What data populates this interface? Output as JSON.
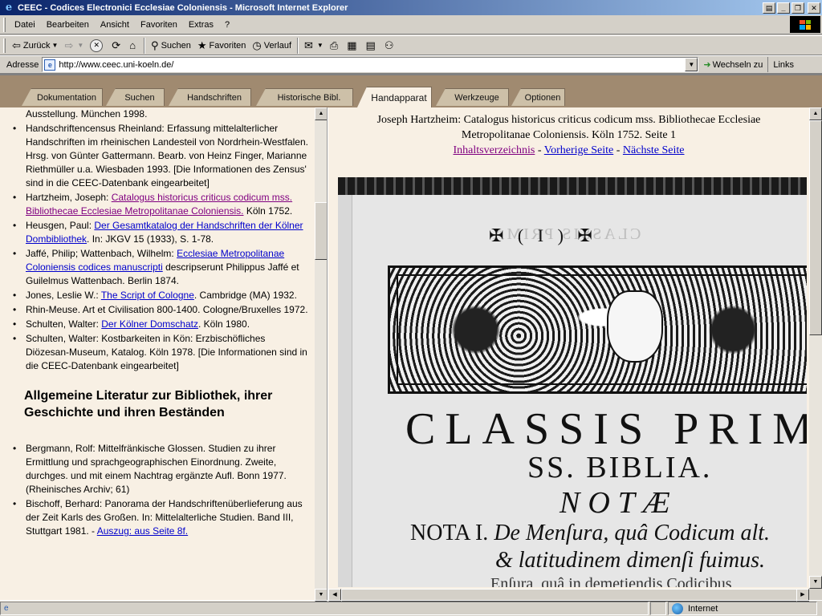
{
  "window": {
    "title": "CEEC - Codices Electronici Ecclesiae Coloniensis - Microsoft Internet Explorer"
  },
  "menu": [
    "Datei",
    "Bearbeiten",
    "Ansicht",
    "Favoriten",
    "Extras",
    "?"
  ],
  "toolbar": {
    "back": "Zurück",
    "search": "Suchen",
    "favorites": "Favoriten",
    "history": "Verlauf"
  },
  "address": {
    "label": "Adresse",
    "url": "http://www.ceec.uni-koeln.de/",
    "go": "Wechseln zu",
    "links": "Links"
  },
  "tabs": [
    {
      "label": "Dokumentation"
    },
    {
      "label": "Suchen"
    },
    {
      "label": "Handschriften"
    },
    {
      "label": "Historische Bibl."
    },
    {
      "label": "Handapparat"
    },
    {
      "label": "Werkzeuge"
    },
    {
      "label": "Optionen"
    }
  ],
  "active_tab": "Handapparat",
  "left": {
    "items_top": [
      {
        "pre": "Ausstellung. München 1998.",
        "link": "",
        "post": "",
        "bullet": false
      },
      {
        "pre": "Handschriftencensus Rheinland: Erfassung mittelalterlicher Handschriften im rheinischen Landesteil von Nordrhein-Westfalen. Hrsg. von Günter Gattermann. Bearb. von Heinz Finger, Marianne Riethmüller u.a. Wiesbaden 1993. [Die Informationen des Zensus' sind in die CEEC-Datenbank eingearbeitet]",
        "link": "",
        "post": "",
        "bullet": true
      },
      {
        "pre": "Hartzheim, Joseph: ",
        "link": "Catalogus historicus criticus codicum mss. Bibliothecae Ecclesiae Metropolitanae Coloniensis.",
        "post": " Köln 1752.",
        "bullet": true,
        "visited": true
      },
      {
        "pre": "Heusgen, Paul: ",
        "link": "Der Gesamtkatalog der Handschriften der Kölner Dombibliothek",
        "post": ". In: JKGV 15 (1933), S. 1-78.",
        "bullet": true
      },
      {
        "pre": "Jaffé, Philip; Wattenbach, Wilhelm: ",
        "link": "Ecclesiae Metropolitanae Coloniensis codices manuscripti",
        "post": " descripserunt Philippus Jaffé et Guilelmus Wattenbach. Berlin 1874.",
        "bullet": true
      },
      {
        "pre": "Jones, Leslie W.: ",
        "link": "The Script of Cologne",
        "post": ". Cambridge (MA) 1932.",
        "bullet": true
      },
      {
        "pre": "Rhin-Meuse. Art et Civilisation 800-1400. Cologne/Bruxelles 1972.",
        "link": "",
        "post": "",
        "bullet": true
      },
      {
        "pre": "Schulten, Walter: ",
        "link": "Der Kölner Domschatz",
        "post": ". Köln 1980.",
        "bullet": true
      },
      {
        "pre": "Schulten, Walter: Kostbarkeiten in Kön: Erzbischöfliches Diözesan-Museum, Katalog. Köln 1978. [Die Informationen sind in die CEEC-Datenbank eingearbeitet]",
        "link": "",
        "post": "",
        "bullet": true
      }
    ],
    "heading": "Allgemeine Literatur zur Bibliothek, ihrer Geschichte und ihren Beständen",
    "items_bottom": [
      {
        "pre": "Bergmann, Rolf: Mittelfränkische Glossen. Studien zu ihrer Ermittlung und sprachgeographischen Einordnung. Zweite, durchges. und mit einem Nachtrag ergänzte Aufl. Bonn 1977. (Rheinisches Archiv; 61)",
        "link": "",
        "post": "",
        "bullet": true
      },
      {
        "pre": "Bischoff, Berhard: Panorama der Handschriftenüberlieferung aus der Zeit Karls des Großen. In: Mittelalterliche Studien. Band III, Stuttgart 1981. - ",
        "link": "Auszug: aus Seite 8f.",
        "post": "",
        "bullet": true
      }
    ]
  },
  "right": {
    "title_line1": "Joseph Hartzheim: Catalogus historicus criticus codicum mss. Bibliothecae Ecclesiae",
    "title_line2": "Metropolitanae Coloniensis. Köln 1752. Seite 1",
    "nav_toc": "Inhaltsverzeichnis",
    "nav_sep": " - ",
    "nav_prev": "Vorherige Seite",
    "nav_next": "Nächste Seite",
    "scan": {
      "header": "✠ ( I ) ✠",
      "ghost": "CLASSIS PRIMA",
      "line1": "CLASSIS PRIM",
      "line2": "SS. BIBLIA.",
      "line3": "NOTÆ",
      "line4_a": "NOTA I.",
      "line4_b": " De Menſura, quâ Codicum alt.",
      "line5": "& latitudinem dimenſi fuimus.",
      "line6": "Enſura, quâ in demetiendis Codicibus"
    }
  },
  "status": {
    "zone": "Internet"
  }
}
